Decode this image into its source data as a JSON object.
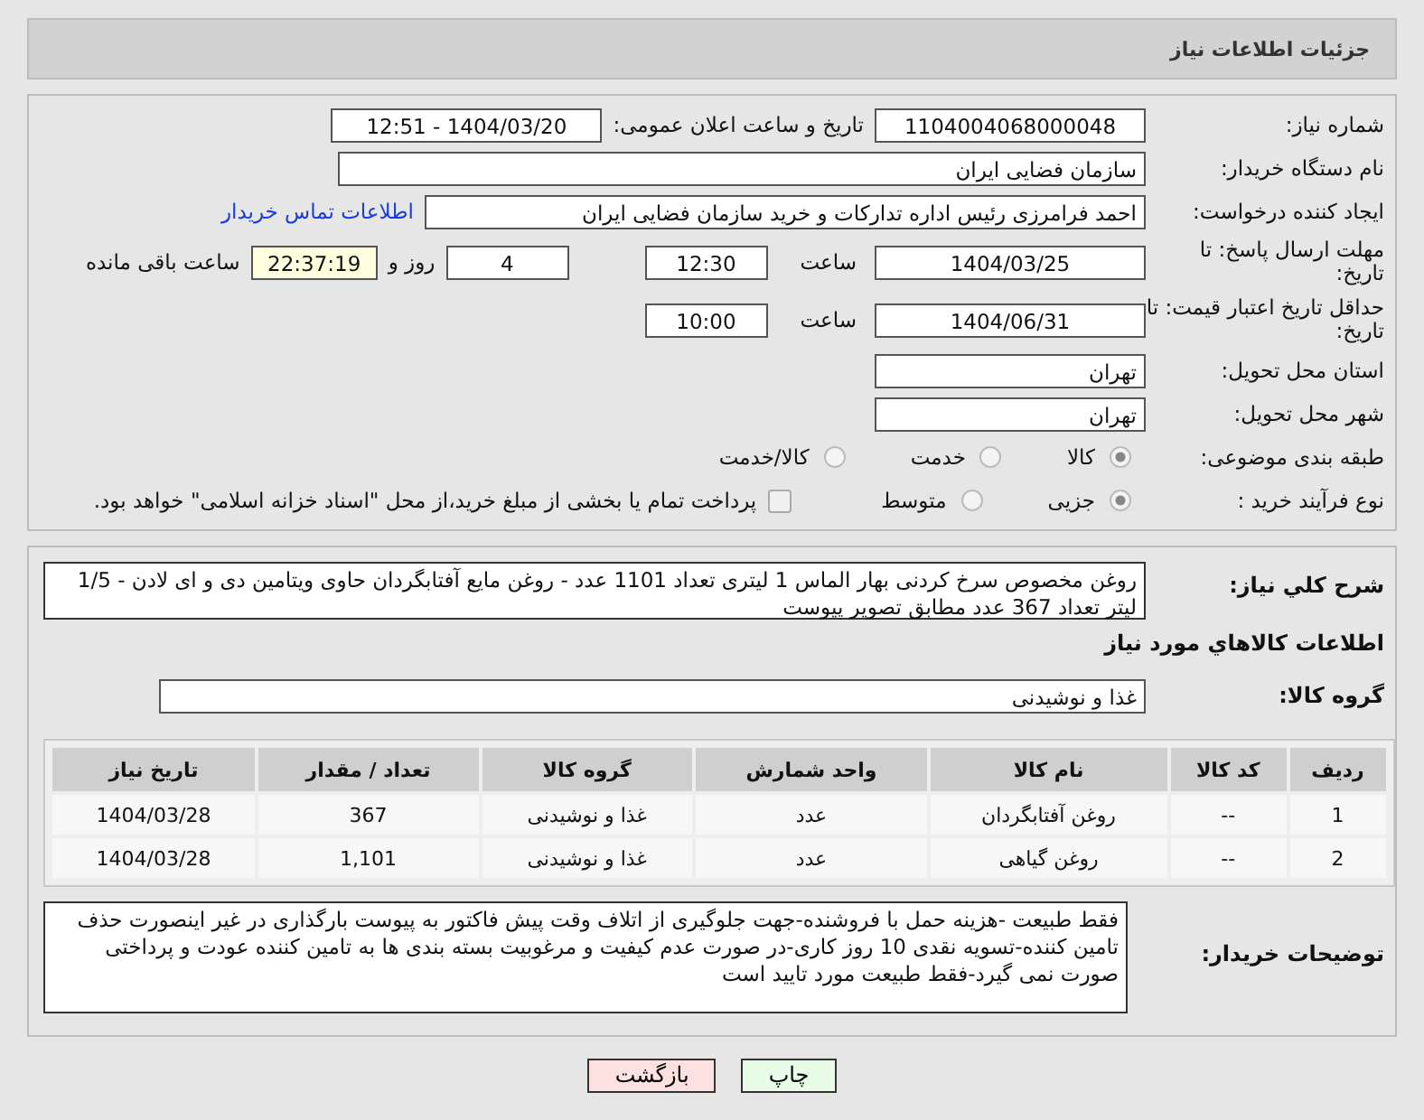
{
  "header": {
    "title": "جزئیات اطلاعات نیاز"
  },
  "need_number": {
    "label": "شماره نیاز:",
    "value": "1104004068000048"
  },
  "announce": {
    "label": "تاریخ و ساعت اعلان عمومی:",
    "value": "1404/03/20 - 12:51"
  },
  "buyer_org": {
    "label": "نام دستگاه خریدار:",
    "value": "سازمان فضایی ایران"
  },
  "creator": {
    "label": "ایجاد کننده درخواست:",
    "value": "احمد فرامرزی رئیس اداره تدارکات و خرید سازمان فضایی ایران",
    "link": "اطلاعات تماس خریدار"
  },
  "deadline": {
    "label": "مهلت ارسال پاسخ: تا تاریخ:",
    "date": "1404/03/25",
    "time_label": "ساعت",
    "time": "12:30",
    "days": "4",
    "days_label": "روز و",
    "remaining": "22:37:19",
    "remaining_label": "ساعت باقی مانده"
  },
  "validity": {
    "label": "حداقل تاریخ اعتبار قیمت: تا تاریخ:",
    "date": "1404/06/31",
    "time_label": "ساعت",
    "time": "10:00"
  },
  "province": {
    "label": "استان محل تحویل:",
    "value": "تهران"
  },
  "city": {
    "label": "شهر محل تحویل:",
    "value": "تهران"
  },
  "category": {
    "label": "طبقه بندی موضوعی:",
    "options": [
      {
        "label": "کالا",
        "selected": true
      },
      {
        "label": "خدمت",
        "selected": false
      },
      {
        "label": "کالا/خدمت",
        "selected": false
      }
    ]
  },
  "process": {
    "label": "نوع فرآیند خرید :",
    "options": [
      {
        "label": "جزیی",
        "selected": true
      },
      {
        "label": "متوسط",
        "selected": false
      }
    ],
    "payment_checked": false,
    "payment_text": "پرداخت تمام یا بخشی از مبلغ خرید،از محل \"اسناد خزانه اسلامی\" خواهد بود."
  },
  "description": {
    "label": "شرح کلي نياز:",
    "value": "روغن مخصوص سرخ کردنی بهار الماس 1 لیتری تعداد 1101 عدد - روغن مایع آفتابگردان حاوی ویتامین دی و ای لادن - 1/5 لیتر  تعداد 367 عدد مطابق تصویر پیوست"
  },
  "items_title": "اطلاعات کالاهاي مورد نياز",
  "goods_group": {
    "label": "گروه کالا:",
    "value": "غذا و نوشیدنی"
  },
  "table": {
    "columns": [
      "ردیف",
      "کد کالا",
      "نام کالا",
      "واحد شمارش",
      "گروه کالا",
      "تعداد / مقدار",
      "تاریخ نیاز"
    ],
    "rows": [
      [
        "1",
        "--",
        "روغن آفتابگردان",
        "عدد",
        "غذا و نوشیدنی",
        "367",
        "1404/03/28"
      ],
      [
        "2",
        "--",
        "روغن گیاهی",
        "عدد",
        "غذا و نوشیدنی",
        "1,101",
        "1404/03/28"
      ]
    ]
  },
  "buyer_notes": {
    "label": "توضیحات خریدار:",
    "value": "فقط طبیعت -هزینه حمل با فروشنده-جهت جلوگیری از اتلاف وقت پیش فاکتور به پیوست بارگذاری در غیر اینصورت حذف تامین کننده-تسویه نقدی 10 روز کاری-در صورت عدم کیفیت و مرغوبیت بسته بندی ها به تامین کننده عودت و پرداختی صورت نمی گیرد-فقط طبیعت مورد تایید است"
  },
  "buttons": [
    {
      "label": "چاپ",
      "kind": "print"
    },
    {
      "label": "بازگشت",
      "kind": "back"
    }
  ]
}
